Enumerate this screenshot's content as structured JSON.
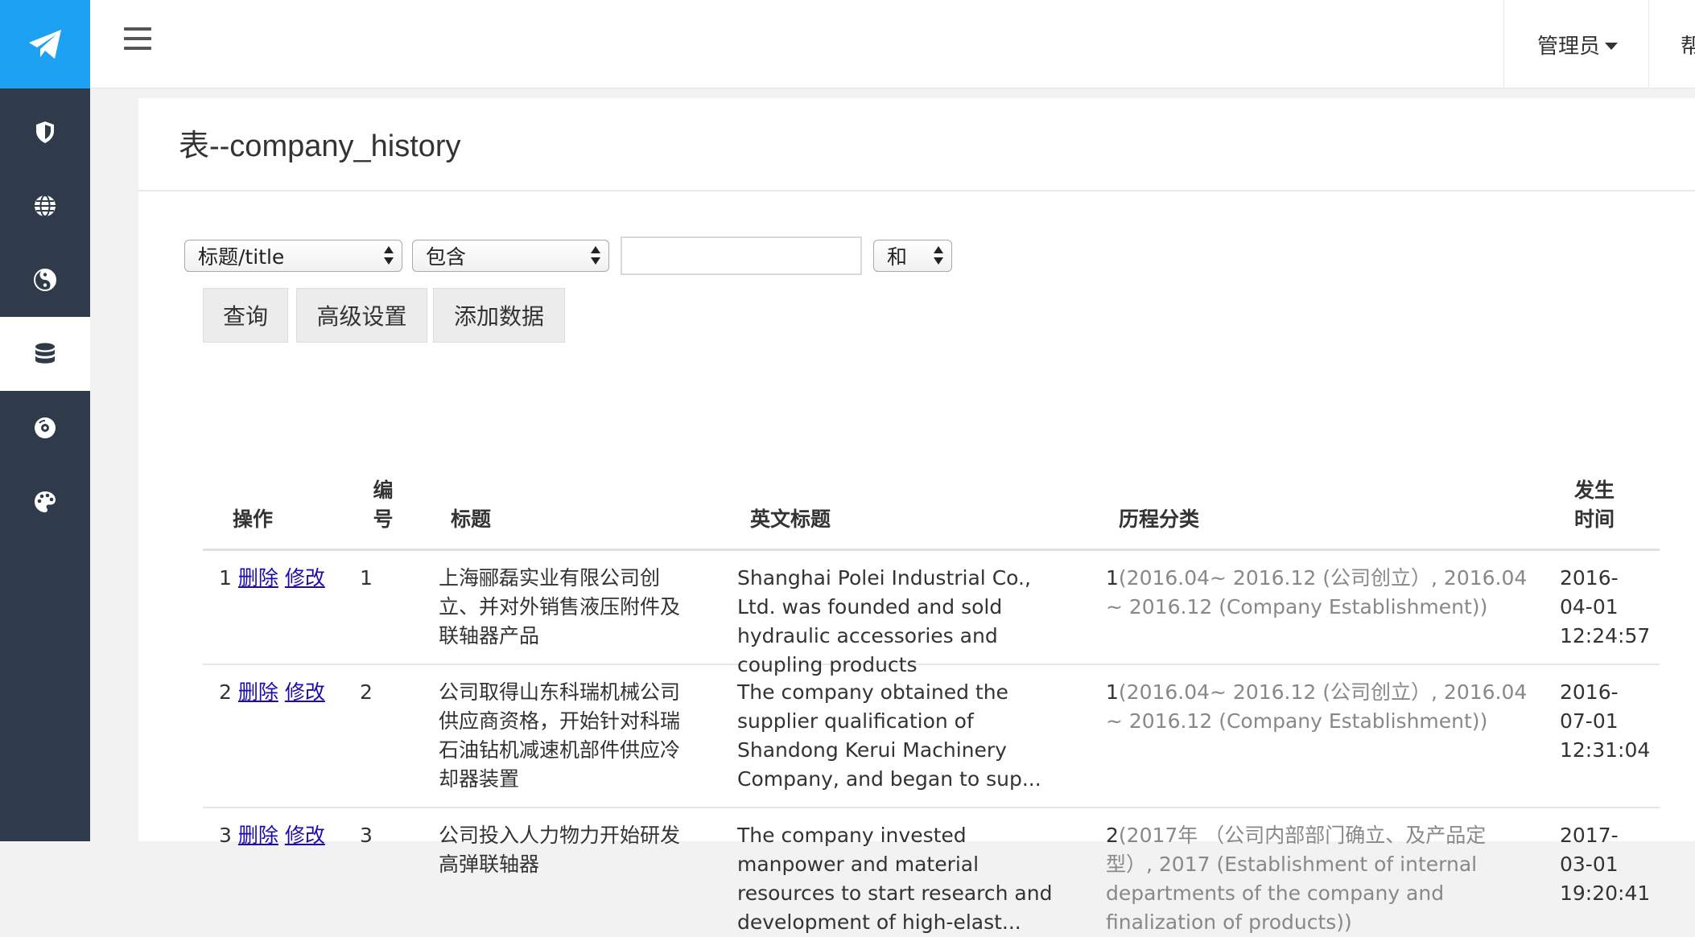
{
  "header": {
    "user_menu_label": "管理员",
    "help_menu_label": "帮"
  },
  "sidebar": {
    "items": [
      {
        "icon": "shield-icon"
      },
      {
        "icon": "globe-icon"
      },
      {
        "icon": "yin-yang-icon"
      },
      {
        "icon": "database-icon",
        "active": true
      },
      {
        "icon": "disc-icon"
      },
      {
        "icon": "palette-icon"
      }
    ]
  },
  "page": {
    "title": "表--company_history"
  },
  "filter": {
    "field_select": "标题/title",
    "operator_select": "包含",
    "value_input": "",
    "logic_select": "和"
  },
  "buttons": {
    "query": "查询",
    "advanced": "高级设置",
    "add": "添加数据"
  },
  "table": {
    "headers": {
      "ops": "操作",
      "id": "编号",
      "title": "标题",
      "en_title": "英文标题",
      "category": "历程分类",
      "time": "发生时间"
    },
    "delete_label": "删除",
    "edit_label": "修改",
    "rows": [
      {
        "index": "1",
        "id": "1",
        "title": "上海郦磊实业有限公司创立、并对外销售液压附件及联轴器产品",
        "en_title": "Shanghai Polei Industrial Co., Ltd. was founded and sold hydraulic accessories and coupling products",
        "category_id": "1",
        "category": "(2016.04~ 2016.12 (公司创立）, 2016.04 ~ 2016.12 (Company Establishment))",
        "time": "2016-04-01 12:24:57"
      },
      {
        "index": "2",
        "id": "2",
        "title": "公司取得山东科瑞机械公司供应商资格，开始针对科瑞石油钻机减速机部件供应冷却器装置",
        "en_title": "The company obtained the supplier qualification of Shandong Kerui Machinery Company, and began to sup...",
        "category_id": "1",
        "category": "(2016.04~ 2016.12 (公司创立）, 2016.04 ~ 2016.12 (Company Establishment))",
        "time": "2016-07-01 12:31:04"
      },
      {
        "index": "3",
        "id": "3",
        "title": "公司投入人力物力开始研发高弹联轴器",
        "en_title": "The company invested manpower and material resources to start research and development of high-elast...",
        "category_id": "2",
        "category": "(2017年 （公司内部部门确立、及产品定型）, 2017 (Establishment of internal departments of the company and finalization of products))",
        "time": "2017-03-01 19:20:41"
      }
    ]
  }
}
